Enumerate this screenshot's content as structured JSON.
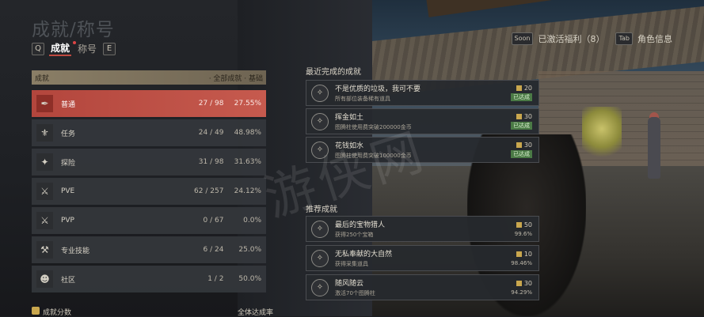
{
  "header": {
    "title": "成就/称号"
  },
  "tabs": {
    "prev_key": "Q",
    "next_key": "E",
    "items": [
      {
        "label": "成就"
      },
      {
        "label": "称号"
      }
    ]
  },
  "top_right": {
    "rewards_key": "Soon",
    "rewards_label": "已激活福利（8）",
    "char_key": "Tab",
    "char_label": "角色信息"
  },
  "panel": {
    "head_left": "成就",
    "head_right": "· 全部成就 · 基础"
  },
  "categories": [
    {
      "name": "普通",
      "count": "27 / 98",
      "pct": "27.55%",
      "icon": "quill-icon",
      "glyph": "✒"
    },
    {
      "name": "任务",
      "count": "24 / 49",
      "pct": "48.98%",
      "icon": "scroll-icon",
      "glyph": "⚜"
    },
    {
      "name": "探险",
      "count": "31 / 98",
      "pct": "31.63%",
      "icon": "compass-icon",
      "glyph": "✦"
    },
    {
      "name": "PVE",
      "count": "62 / 257",
      "pct": "24.12%",
      "icon": "sword-shield-icon",
      "glyph": "⚔"
    },
    {
      "name": "PVP",
      "count": "0 / 67",
      "pct": "0.0%",
      "icon": "crossed-swords-icon",
      "glyph": "⚔"
    },
    {
      "name": "专业技能",
      "count": "6 / 24",
      "pct": "25.0%",
      "icon": "tools-icon",
      "glyph": "⚒"
    },
    {
      "name": "社区",
      "count": "1 / 2",
      "pct": "50.0%",
      "icon": "people-icon",
      "glyph": "☻"
    }
  ],
  "stats": {
    "score_label": "成就分数",
    "rate_label": "全体达成率"
  },
  "recent": {
    "title": "最近完成的成就",
    "items": [
      {
        "name": "不是优质的垃圾，我可不要",
        "desc": "所有部位装备稀有道具",
        "points": "20",
        "status": "已达成"
      },
      {
        "name": "挥金如土",
        "desc": "图腾柱使用费突破200000金币",
        "points": "30",
        "status": "已达成"
      },
      {
        "name": "花钱如水",
        "desc": "图腾柱使用费突破100000金币",
        "points": "30",
        "status": "已达成"
      }
    ]
  },
  "recommended": {
    "title": "推荐成就",
    "items": [
      {
        "name": "最后的宝物猎人",
        "desc": "获得250个宝箱",
        "points": "50",
        "rate": "99.6%"
      },
      {
        "name": "无私奉献的大自然",
        "desc": "获得采集道具",
        "points": "10",
        "rate": "98.46%"
      },
      {
        "name": "随风随云",
        "desc": "激活70个图腾柱",
        "points": "30",
        "rate": "94.29%"
      }
    ]
  },
  "watermark": "游侠网"
}
